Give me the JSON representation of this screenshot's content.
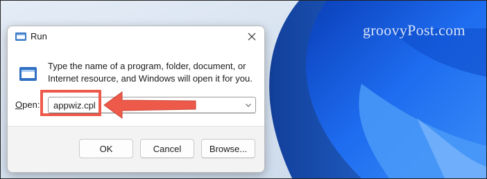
{
  "watermark": "groovyPost.com",
  "dialog": {
    "title": "Run",
    "description": "Type the name of a program, folder, document, or Internet resource, and Windows will open it for you.",
    "open_label_prefix": "O",
    "open_label_rest": "pen:",
    "open_value": "appwiz.cpl"
  },
  "buttons": {
    "ok": "OK",
    "cancel": "Cancel",
    "browse": "Browse..."
  },
  "icons": {
    "title": "run-icon",
    "dialog": "run-icon",
    "close": "close-icon",
    "dropdown": "chevron-down-icon",
    "annotation": "arrow-annotation"
  },
  "colors": {
    "accent": "#ed5a4a",
    "wallpaper_blue": "#1a64d6"
  }
}
